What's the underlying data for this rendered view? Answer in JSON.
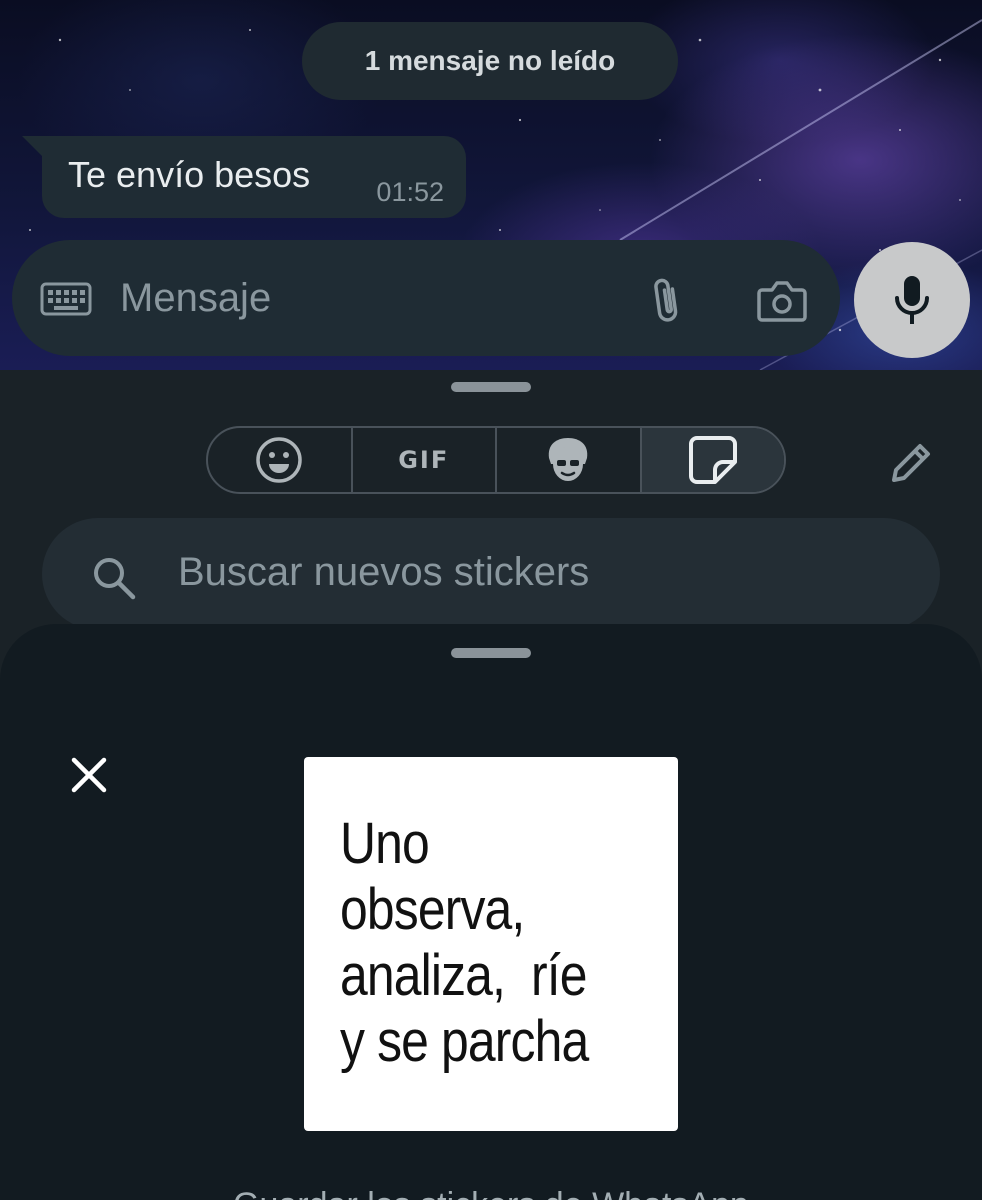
{
  "chat": {
    "unread_banner": "1 mensaje no leído",
    "messages": [
      {
        "text": "Te envío besos",
        "time": "01:52"
      }
    ]
  },
  "composer": {
    "placeholder": "Mensaje",
    "left_icon": "keyboard-icon",
    "attach_icon": "paperclip-icon",
    "camera_icon": "camera-icon",
    "action_icon": "microphone-icon"
  },
  "picker": {
    "tabs": [
      {
        "id": "emoji",
        "icon": "smiley-icon"
      },
      {
        "id": "gif",
        "label": "GIF"
      },
      {
        "id": "avatar",
        "icon": "avatar-icon"
      },
      {
        "id": "stickers",
        "icon": "sticker-icon",
        "selected": true
      }
    ],
    "edit_icon": "pencil-icon",
    "search_placeholder": "Buscar nuevos stickers"
  },
  "sticker_sheet": {
    "close_icon": "close-icon",
    "sticker_text": "Uno\nobserva,\nanaliza,  ríe\ny se parcha",
    "footer": "Guardar los stickers de WhatsApp"
  },
  "colors": {
    "panel_bg": "#1a2227",
    "bubble_bg": "#1f2c34",
    "accent_mic": "#c8c9ca"
  }
}
